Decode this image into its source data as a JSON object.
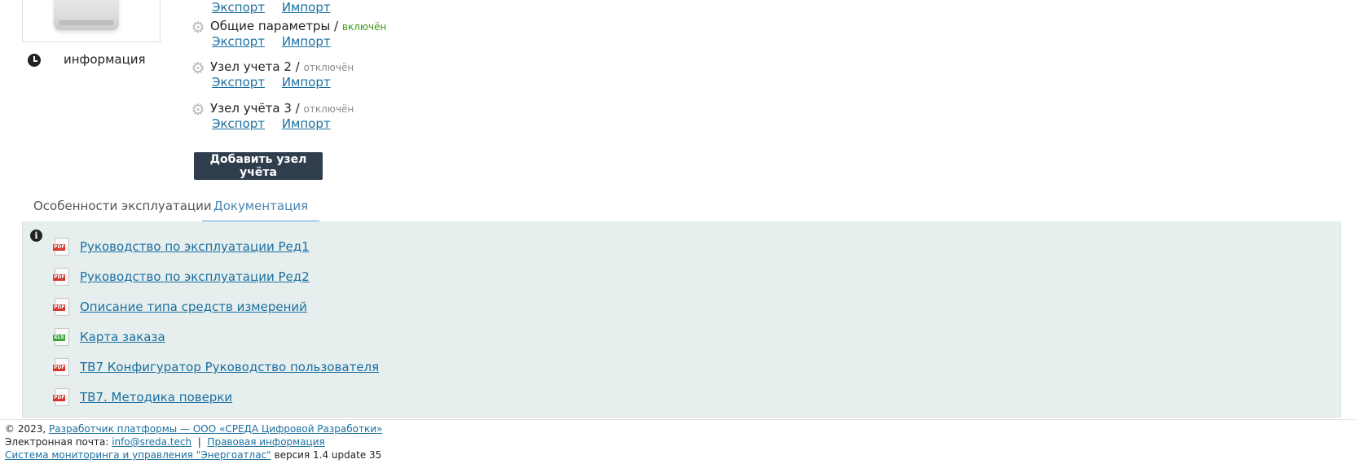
{
  "device": {
    "info_label": "информация",
    "info_icon": "clock-icon"
  },
  "nodes": [
    {
      "title": "",
      "status": "",
      "export_label": "Экспорт",
      "import_label": "Импорт"
    },
    {
      "title": "Общие параметры /",
      "status": "включён",
      "export_label": "Экспорт",
      "import_label": "Импорт"
    },
    {
      "title": "Узел учета 2 /",
      "status": "отключён",
      "export_label": "Экспорт",
      "import_label": "Импорт"
    },
    {
      "title": "Узел учёта 3 /",
      "status": "отключён",
      "export_label": "Экспорт",
      "import_label": "Импорт"
    }
  ],
  "add_node_button": "Добавить узел учёта",
  "tabs": [
    {
      "label": "Особенности эксплуатации",
      "active": false
    },
    {
      "label": "Документация",
      "active": true
    }
  ],
  "documents": [
    {
      "type": "PDF",
      "title": "Руководство по эксплуатации Ред1"
    },
    {
      "type": "PDF",
      "title": "Руководство по эксплуатации Ред2"
    },
    {
      "type": "PDF",
      "title": "Описание типа средств измерений"
    },
    {
      "type": "XLS",
      "title": "Карта заказа"
    },
    {
      "type": "PDF",
      "title": "ТВ7 Конфигуратор Руководство пользователя"
    },
    {
      "type": "PDF",
      "title": "ТВ7. Методика поверки"
    }
  ],
  "footer": {
    "copyright": "© 2023,",
    "developer_link": "Разработчик платформы — ООО «СРЕДА Цифровой Разработки»",
    "email_label": "Электронная почта:",
    "email_link": "info@sreda.tech",
    "separator": "|",
    "legal_link": "Правовая информация",
    "system_link": "Система мониторинга и управления \"Энергоатлас\"",
    "version": "версия 1.4 update 35"
  },
  "colors": {
    "status_on": "#3a9a12",
    "status_off": "#8c8c8c",
    "link": "#1a6fa0",
    "button_bg": "#2f3d4c",
    "panel_bg": "#e6efee",
    "active_tab": "#5aa8d8"
  }
}
